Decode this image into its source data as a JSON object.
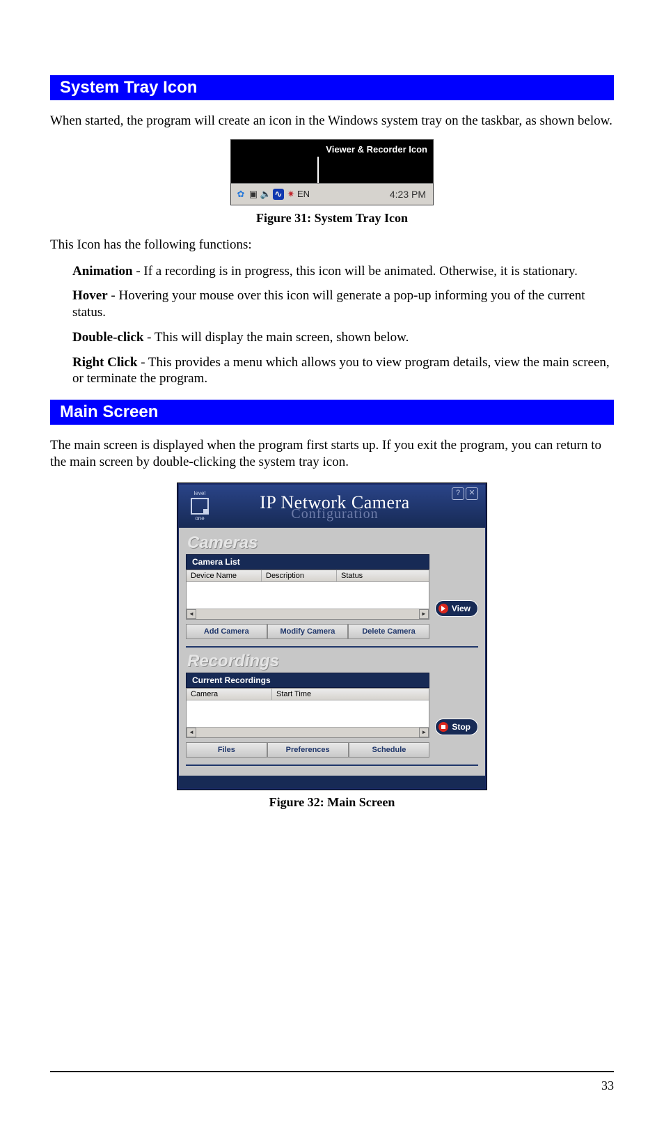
{
  "page_number": "33",
  "sections": {
    "tray": {
      "heading": "System Tray Icon",
      "intro": "When started, the program will create an icon in the Windows system tray on the taskbar, as shown below.",
      "caption": "Figure 31: System Tray Icon",
      "functions_intro": "This Icon has the following functions:",
      "items": {
        "animation_label": "Animation",
        "animation_text": " - If a recording is in progress, this icon will be animated. Otherwise, it is stationary.",
        "hover_label": "Hover",
        "hover_text": " - Hovering your mouse over this icon will generate a pop-up informing you of the current status.",
        "double_label": "Double-click",
        "double_text": " - This will display the main screen, shown below.",
        "right_label": "Right Click",
        "right_text": " - This provides a menu which allows you to view program details, view the main screen, or terminate the program."
      }
    },
    "main": {
      "heading": "Main Screen",
      "intro": "The main screen is displayed when the program first starts up. If you exit the program, you can return to the main screen by double-clicking the system tray icon.",
      "caption": "Figure 32: Main Screen"
    }
  },
  "fig31": {
    "callout": "Viewer & Recorder Icon",
    "lang": "EN",
    "time": "4:23 PM"
  },
  "fig32": {
    "logo_top": "level",
    "logo_bottom": "one",
    "title_main": "IP Network Camera",
    "title_sub": "Configuration",
    "help": "?",
    "close": "✕",
    "cameras": {
      "section": "Cameras",
      "list_label": "Camera List",
      "cols": {
        "c1": "Device Name",
        "c2": "Description",
        "c3": "Status"
      },
      "add": "Add Camera",
      "modify": "Modify Camera",
      "delete": "Delete Camera",
      "view": "View"
    },
    "recordings": {
      "section": "Recordings",
      "list_label": "Current Recordings",
      "cols": {
        "c1": "Camera",
        "c2": "Start Time"
      },
      "files": "Files",
      "prefs": "Preferences",
      "schedule": "Schedule",
      "stop": "Stop"
    }
  }
}
